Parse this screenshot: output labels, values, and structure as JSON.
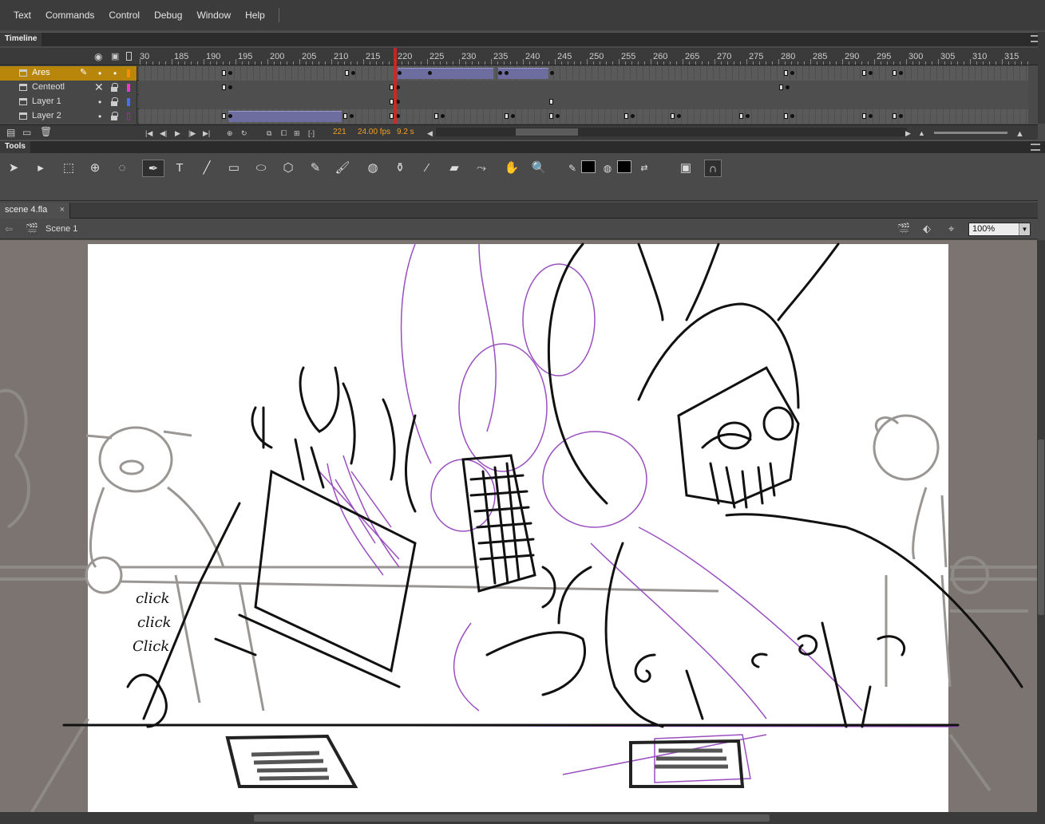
{
  "menu": [
    "Text",
    "Commands",
    "Control",
    "Debug",
    "Window",
    "Help"
  ],
  "timeline": {
    "panel_title": "Timeline",
    "ruler_labels": [
      "30",
      "185",
      "190",
      "195",
      "200",
      "205",
      "210",
      "215",
      "220",
      "225",
      "230",
      "235",
      "240",
      "245",
      "250",
      "255",
      "260",
      "265",
      "270",
      "275",
      "280",
      "285",
      "290",
      "295",
      "300",
      "305",
      "310",
      "315"
    ],
    "layers": [
      {
        "name": "Ares",
        "selected": true,
        "color": "#ff8c00"
      },
      {
        "name": "Centeotl",
        "selected": false,
        "color": "#ff33cc"
      },
      {
        "name": "Layer 1",
        "selected": false,
        "color": "#4d6bff"
      },
      {
        "name": "Layer 2",
        "selected": false,
        "color": "#a020c0"
      }
    ],
    "current_frame": "221",
    "fps": "24.00 fps",
    "elapsed": "9.2 s"
  },
  "tools": {
    "panel_title": "Tools",
    "active_tool": "pen-tool"
  },
  "document": {
    "tab_label": "scene 4.fla",
    "scene_label": "Scene 1",
    "zoom": "100%"
  },
  "stage": {
    "handwriting": [
      "click",
      "click",
      "Click"
    ]
  },
  "colors": {
    "stroke": "#000000",
    "fill": "#000000",
    "selected_layer": "#b8860b",
    "playhead": "#dd2222",
    "tween": "#6d6d9f"
  }
}
